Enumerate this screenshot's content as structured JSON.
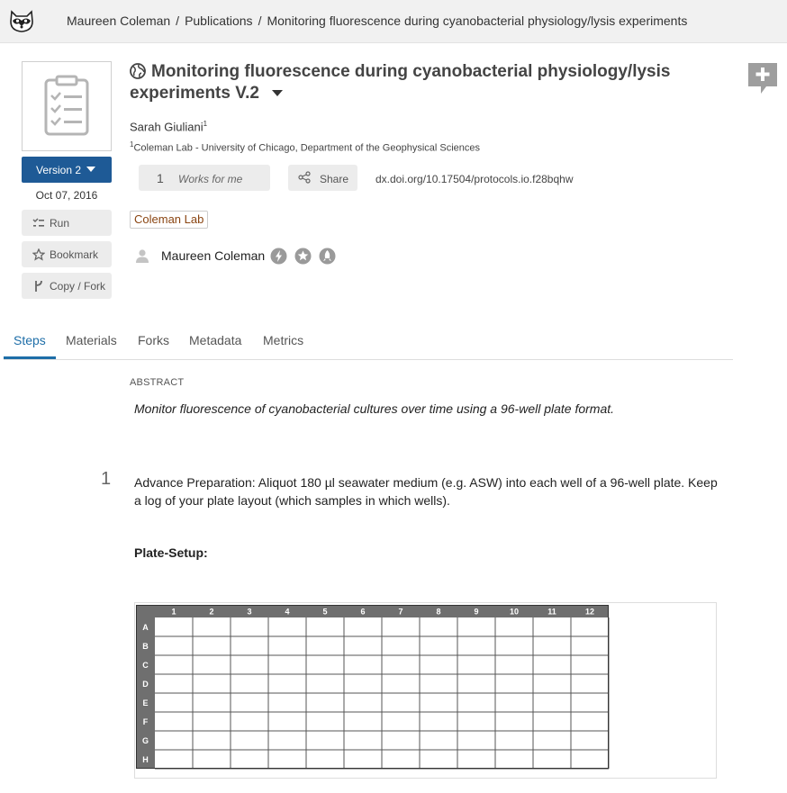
{
  "breadcrumb": {
    "items": [
      "Maureen Coleman",
      "Publications",
      "Monitoring fluorescence during cyanobacterial physiology/lysis experiments"
    ],
    "separator": "/"
  },
  "sidebar": {
    "version_label": "Version 2",
    "date": "Oct 07, 2016",
    "buttons": {
      "run": "Run",
      "bookmark": "Bookmark",
      "copy_fork": "Copy / Fork"
    }
  },
  "protocol": {
    "title": "Monitoring fluorescence during cyanobacterial physiology/lysis experiments V.2",
    "author": "Sarah Giuliani",
    "author_sup": "1",
    "affiliation_sup": "1",
    "affiliation": "Coleman Lab - University of Chicago, Department of the Geophysical Sciences",
    "works_for_me_count": "1",
    "works_for_me_label": "Works for me",
    "share_label": "Share",
    "doi": "dx.doi.org/10.17504/protocols.io.f28bqhw",
    "group_tag": "Coleman Lab",
    "owner": "Maureen Coleman"
  },
  "tabs": [
    {
      "label": "Steps",
      "active": true
    },
    {
      "label": "Materials"
    },
    {
      "label": "Forks"
    },
    {
      "label": "Metadata"
    },
    {
      "label": "Metrics"
    }
  ],
  "content": {
    "abstract_heading": "ABSTRACT",
    "abstract_text": "Monitor fluorescence of cyanobacterial cultures over time using a 96-well plate format.",
    "step_number": "1",
    "step_text": "Advance Preparation: Aliquot 180 µl seawater medium (e.g. ASW) into each well of a 96-well plate. Keep a log of your plate layout (which samples in which wells).",
    "plate_heading": "Plate-Setup:",
    "plate": {
      "columns": [
        "1",
        "2",
        "3",
        "4",
        "5",
        "6",
        "7",
        "8",
        "9",
        "10",
        "11",
        "12"
      ],
      "rows": [
        "A",
        "B",
        "C",
        "D",
        "E",
        "F",
        "G",
        "H"
      ]
    }
  },
  "colors": {
    "primary": "#1e5a96",
    "tab_active": "#1e6ea8",
    "tag_text": "#8a4512",
    "plate_header": "#6f6f6f"
  },
  "icons": [
    "raccoon-logo-icon",
    "add-comment-icon",
    "protocol-thumbnail-icon",
    "globe-icon",
    "run-icon",
    "star-icon",
    "fork-icon",
    "share-icon",
    "user-icon",
    "power-badge-icon",
    "star-badge-icon",
    "rocket-badge-icon"
  ]
}
